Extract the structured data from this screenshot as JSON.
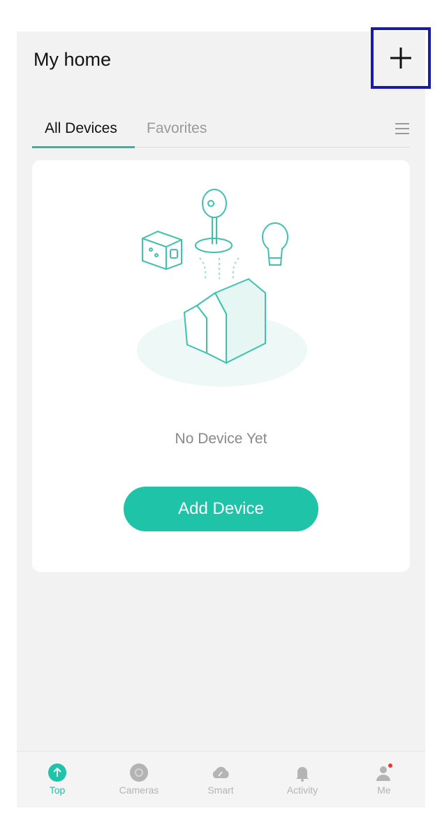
{
  "header": {
    "title": "My home",
    "add_icon": "plus-icon"
  },
  "tabs": [
    {
      "label": "All Devices",
      "active": true
    },
    {
      "label": "Favorites",
      "active": false
    }
  ],
  "tabs_menu_icon": "menu-icon",
  "empty_state": {
    "message": "No Device Yet",
    "button_label": "Add Device"
  },
  "bottom_nav": [
    {
      "label": "Top",
      "icon": "arrow-up-icon",
      "active": true
    },
    {
      "label": "Cameras",
      "icon": "camera-icon",
      "active": false
    },
    {
      "label": "Smart",
      "icon": "cloud-wand-icon",
      "active": false
    },
    {
      "label": "Activity",
      "icon": "bell-icon",
      "active": false
    },
    {
      "label": "Me",
      "icon": "user-icon",
      "active": false,
      "badge": true
    }
  ],
  "colors": {
    "accent": "#1ec3a8",
    "highlight_box": "#1a1aa8",
    "badge": "#e53935"
  }
}
